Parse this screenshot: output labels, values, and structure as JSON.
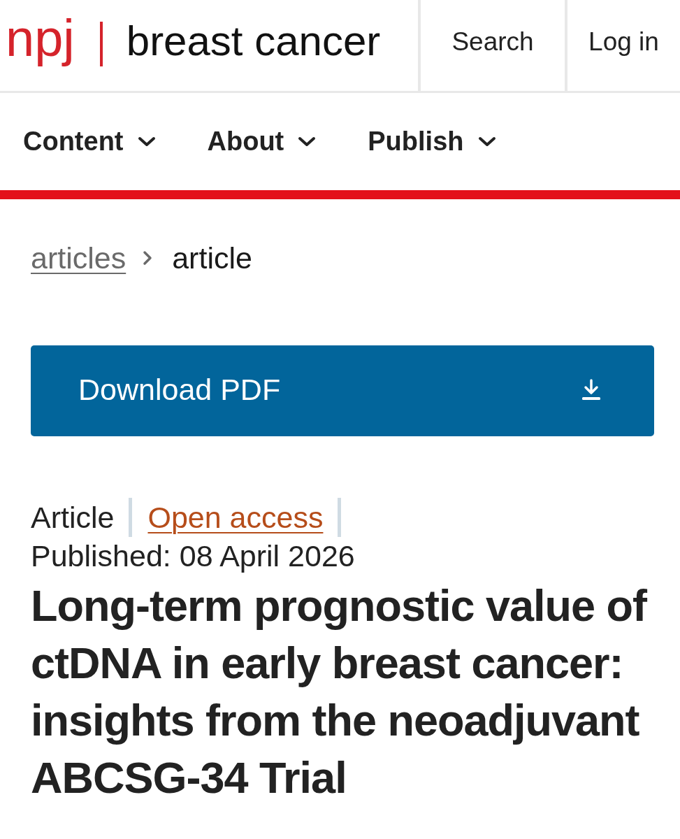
{
  "header": {
    "logo": "npj",
    "journal": "breast cancer",
    "actions": [
      {
        "label": "Search"
      },
      {
        "label": "Log in"
      }
    ]
  },
  "nav": {
    "items": [
      {
        "label": "Content",
        "expanded": false
      },
      {
        "label": "About",
        "expanded": false
      },
      {
        "label": "Publish",
        "expanded": false
      }
    ]
  },
  "breadcrumbs": [
    {
      "label": "articles",
      "current": false
    },
    {
      "label": "article",
      "current": true
    }
  ],
  "download": {
    "label": "Download PDF"
  },
  "article": {
    "type": "Article",
    "access": "Open access",
    "published": "Published: 08 April 2026",
    "title": "Long-term prognostic value of ctDNA in early breast cancer: insights from the neoadjuvant ABCSG-34 Trial"
  }
}
